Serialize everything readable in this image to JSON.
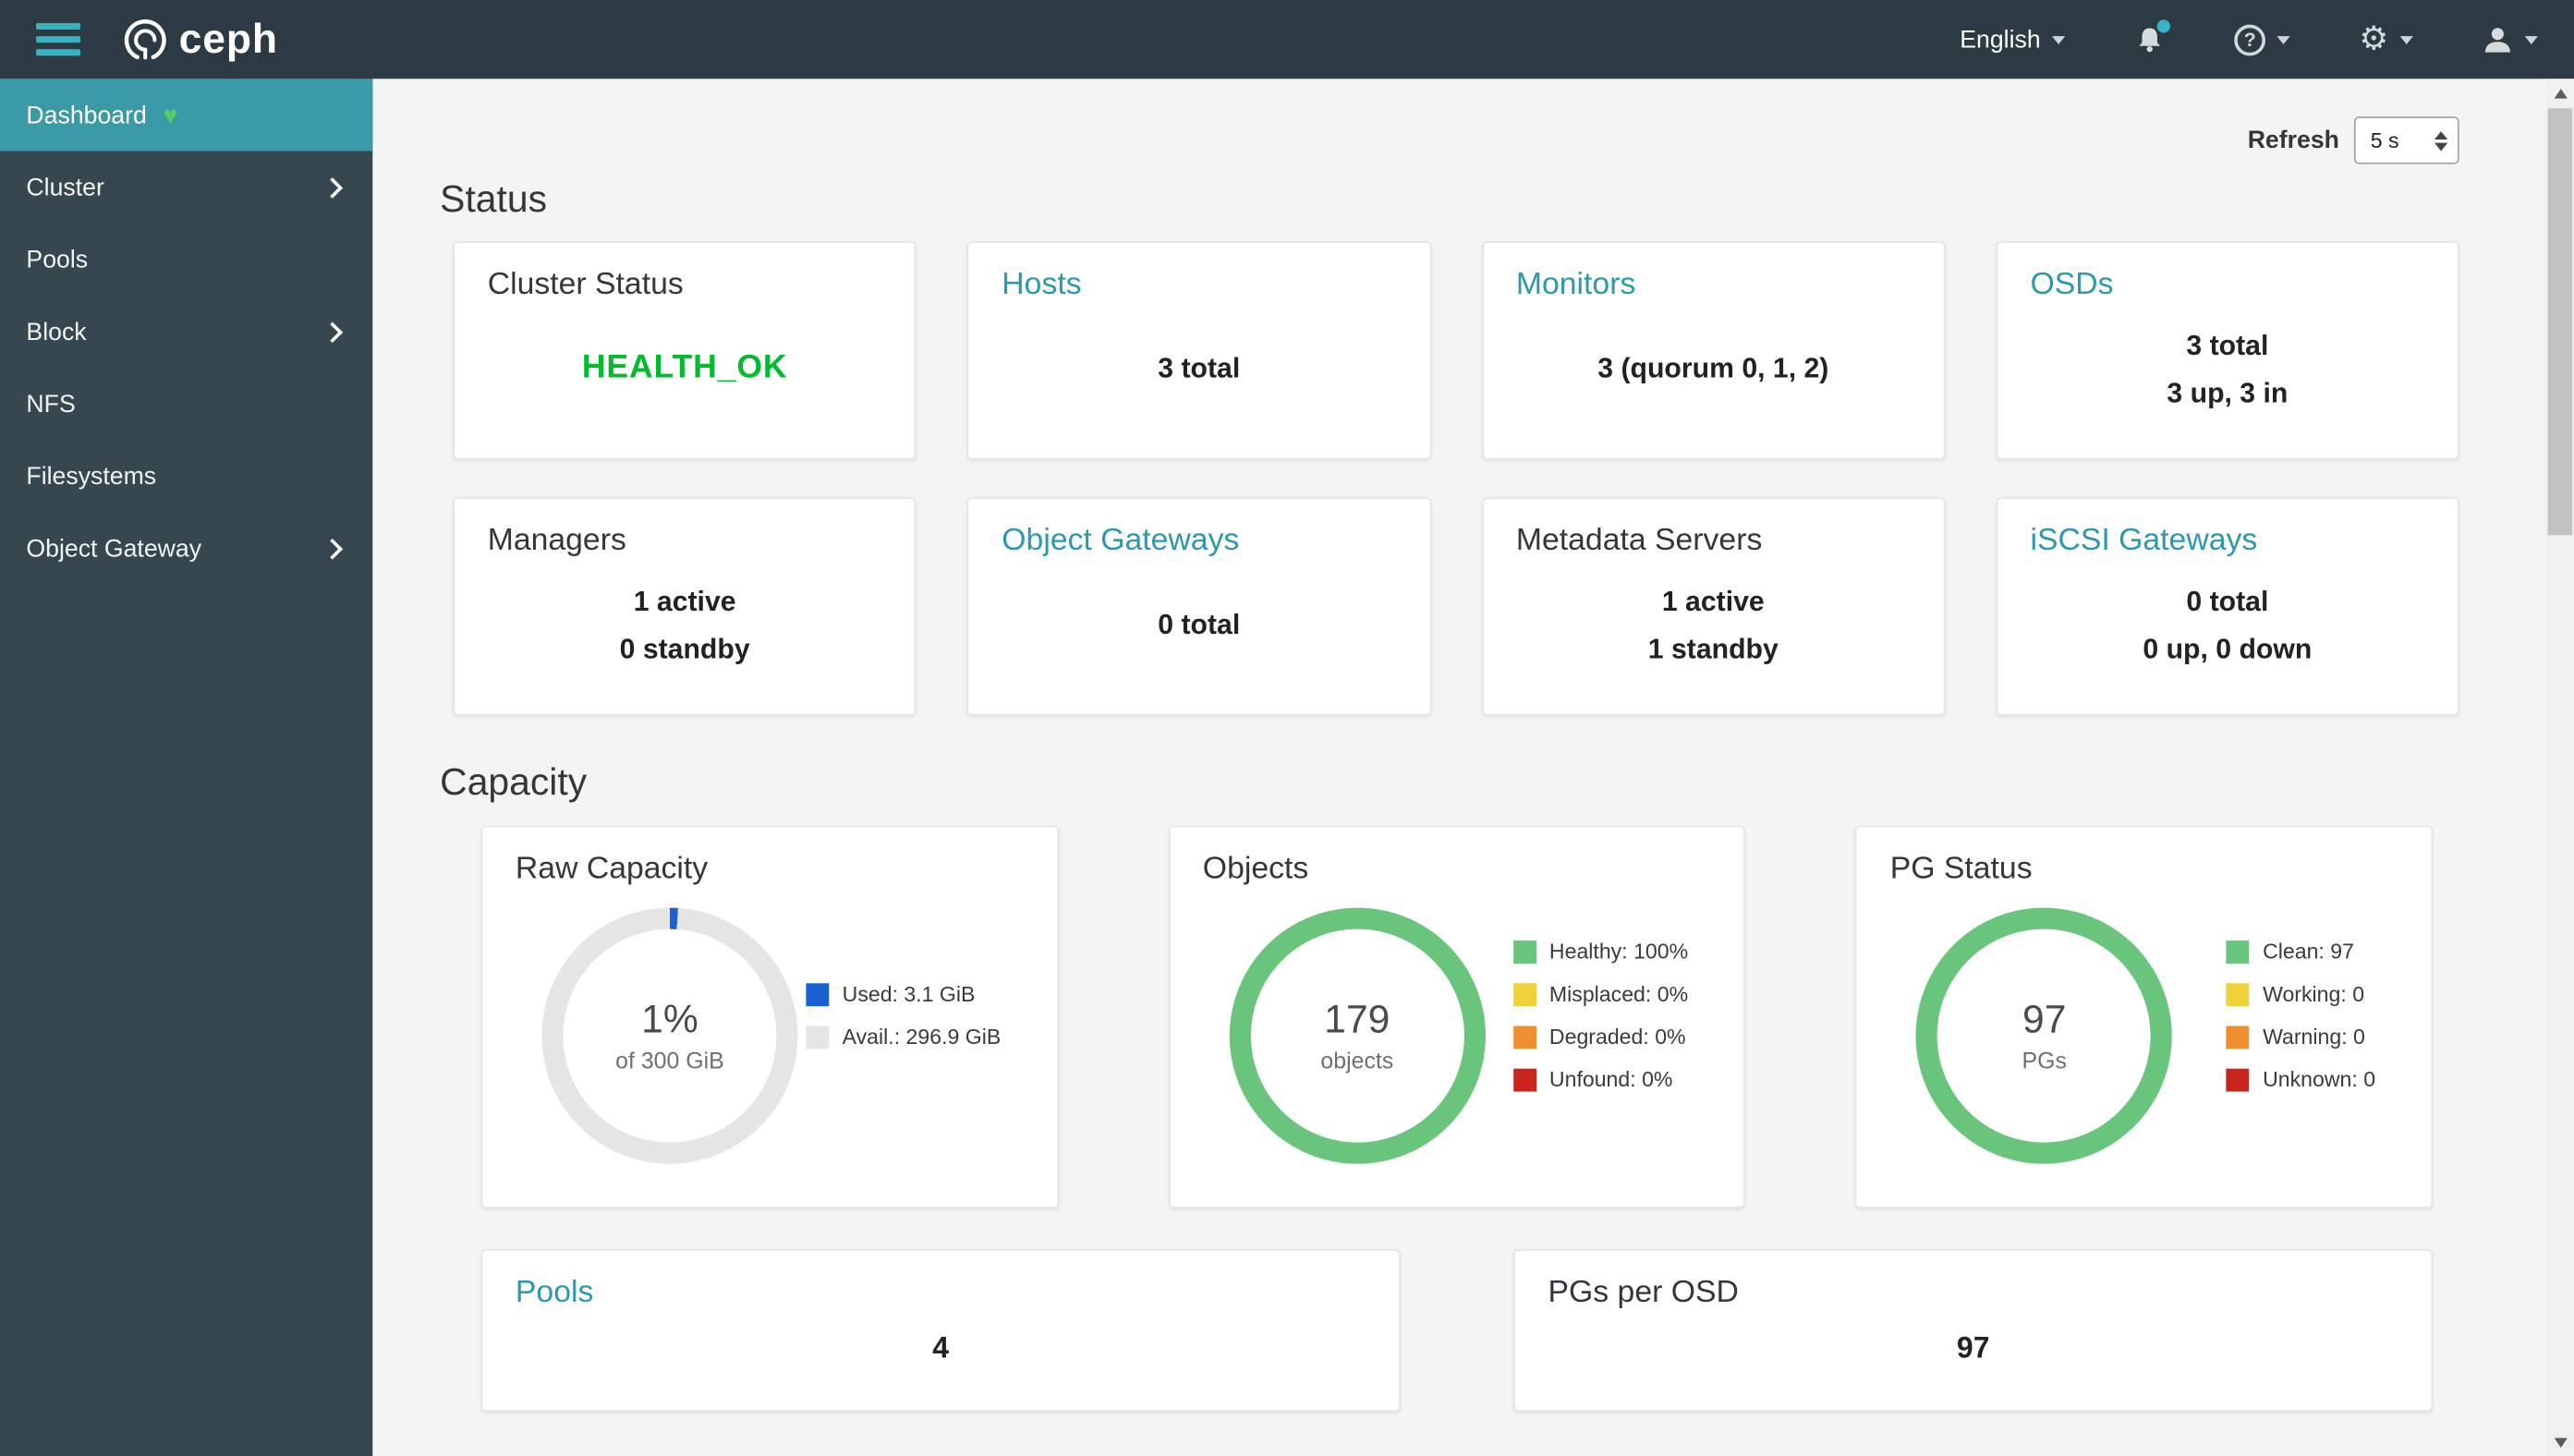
{
  "navbar": {
    "brand": "ceph",
    "language": "English",
    "help_symbol": "?",
    "gear_symbol": "⚙"
  },
  "sidebar": {
    "items": [
      {
        "label": "Dashboard",
        "active": true
      },
      {
        "label": "Cluster",
        "expandable": true
      },
      {
        "label": "Pools"
      },
      {
        "label": "Block",
        "expandable": true
      },
      {
        "label": "NFS"
      },
      {
        "label": "Filesystems"
      },
      {
        "label": "Object Gateway",
        "expandable": true
      }
    ]
  },
  "refresh": {
    "label": "Refresh",
    "value": "5 s"
  },
  "sections": {
    "status": "Status",
    "capacity": "Capacity"
  },
  "status_cards": [
    {
      "title": "Cluster Status",
      "lines": [
        "HEALTH_OK"
      ]
    },
    {
      "title": "Hosts",
      "lines": [
        "3 total"
      ]
    },
    {
      "title": "Monitors",
      "lines": [
        "3 (quorum 0, 1, 2)"
      ]
    },
    {
      "title": "OSDs",
      "lines": [
        "3 total",
        "3 up, 3 in"
      ]
    },
    {
      "title": "Managers",
      "lines": [
        "1 active",
        "0 standby"
      ]
    },
    {
      "title": "Object Gateways",
      "lines": [
        "0 total"
      ]
    },
    {
      "title": "Metadata Servers",
      "lines": [
        "1 active",
        "1 standby"
      ]
    },
    {
      "title": "iSCSI Gateways",
      "lines": [
        "0 total",
        "0 up, 0 down"
      ]
    }
  ],
  "bottom_cards": [
    {
      "title": "Pools",
      "value": "4"
    },
    {
      "title": "PGs per OSD",
      "value": "97"
    }
  ],
  "colors": {
    "accent_teal": "#2b99ac",
    "health_ok_green": "#00bb2d",
    "navbar_bg": "#2c3b43",
    "sidebar_bg": "#37474f",
    "active_item_bg": "#3a9aa6"
  },
  "chart_data": [
    {
      "type": "pie",
      "title": "Raw Capacity",
      "center_value": "1%",
      "center_label": "of 300 GiB",
      "legend_position": "right",
      "series": [
        {
          "name": "Used: 3.1 GiB",
          "value": 1.03,
          "color": "#1a60d1"
        },
        {
          "name": "Avail.: 296.9 GiB",
          "value": 98.97,
          "color": "#e5e5e5"
        }
      ]
    },
    {
      "type": "pie",
      "title": "Objects",
      "center_value": "179",
      "center_label": "objects",
      "legend_position": "right",
      "series": [
        {
          "name": "Healthy: 100%",
          "value": 100,
          "color": "#69c57b"
        },
        {
          "name": "Misplaced: 0%",
          "value": 0,
          "color": "#efd13c"
        },
        {
          "name": "Degraded: 0%",
          "value": 0,
          "color": "#ef8e2e"
        },
        {
          "name": "Unfound: 0%",
          "value": 0,
          "color": "#c9251c"
        }
      ]
    },
    {
      "type": "pie",
      "title": "PG Status",
      "center_value": "97",
      "center_label": "PGs",
      "legend_position": "right",
      "series": [
        {
          "name": "Clean: 97",
          "value": 97,
          "color": "#69c57b"
        },
        {
          "name": "Working: 0",
          "value": 0,
          "color": "#efd13c"
        },
        {
          "name": "Warning: 0",
          "value": 0,
          "color": "#ef8e2e"
        },
        {
          "name": "Unknown: 0",
          "value": 0,
          "color": "#c9251c"
        }
      ]
    }
  ]
}
